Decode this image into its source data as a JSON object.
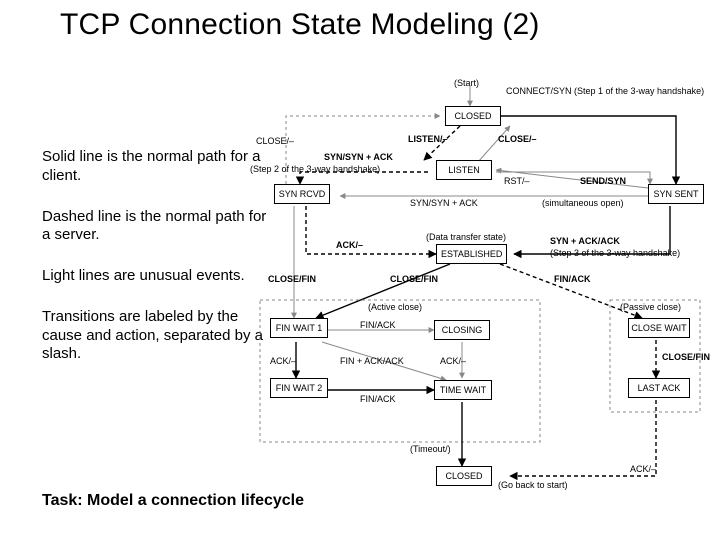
{
  "title": "TCP Connection State Modeling (2)",
  "notes": [
    "Solid line is the normal path for a client.",
    "Dashed line is the normal path for a server.",
    "Light lines are unusual events.",
    "Transitions are labeled by the cause and action, separated by a slash."
  ],
  "task": "Task: Model a connection lifecycle",
  "states": {
    "closed": "CLOSED",
    "listen": "LISTEN",
    "syn_rcvd": "SYN RCVD",
    "syn_sent": "SYN SENT",
    "established": "ESTABLISHED",
    "fin_wait_1": "FIN WAIT 1",
    "fin_wait_2": "FIN WAIT 2",
    "closing": "CLOSING",
    "time_wait": "TIME WAIT",
    "close_wait": "CLOSE WAIT",
    "last_ack": "LAST ACK",
    "closed2": "CLOSED"
  },
  "labels": {
    "start": "(Start)",
    "connect_syn": "CONNECT/SYN (Step 1 of the 3-way handshake)",
    "close_top": "CLOSE/–",
    "listen_dash": "LISTEN/–",
    "syn_synack": "SYN/SYN + ACK",
    "step2": "(Step 2 of the 3-way handshake)",
    "rst": "RST/–",
    "send_syn": "SEND/SYN",
    "syn_synack_mid": "SYN/SYN + ACK",
    "simult_open": "(simultaneous open)",
    "close_left": "CLOSE/–",
    "ack_dash": "ACK/–",
    "syn_ack_ack": "SYN + ACK/ACK",
    "step3": "(Step 3 of the 3-way handshake)",
    "data_state": "(Data transfer state)",
    "close_fin_l": "CLOSE/FIN",
    "close_fin_m": "CLOSE/FIN",
    "fin_ack_r": "FIN/ACK",
    "active_close": "(Active close)",
    "passive_close": "(Passive close)",
    "fin_ack": "FIN/ACK",
    "ack_dash_l": "ACK/–",
    "ack_dash_m": "ACK/–",
    "fin_ack_ack_ack": "FIN + ACK/ACK",
    "close_fin_r": "CLOSE/FIN",
    "fin_ack_b": "FIN/ACK",
    "ack_dash_br": "ACK/–",
    "timeout": "(Timeout/)",
    "go_back": "(Go back to start)"
  }
}
